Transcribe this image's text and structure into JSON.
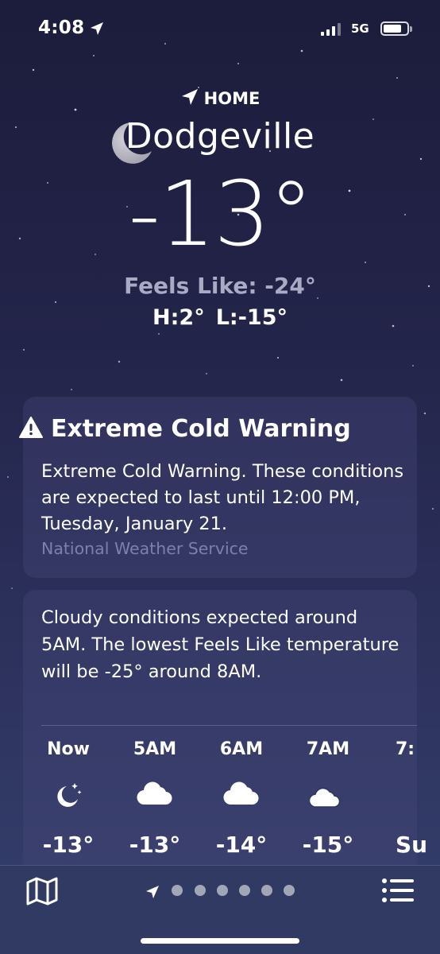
{
  "status_bar": {
    "time": "4:08",
    "network": "5G"
  },
  "header": {
    "home_label": "HOME",
    "city": "Dodgeville",
    "temperature": "-13°",
    "feels_like": "Feels Like: -24°",
    "high": "H:2°",
    "low": "L:-15°"
  },
  "warning": {
    "title": "Extreme Cold Warning",
    "body": "Extreme Cold Warning. These conditions are expected to last until 12:00 PM, Tuesday, January 21.",
    "source": "National Weather Service"
  },
  "hourly": {
    "summary": "Cloudy conditions expected around 5AM. The lowest Feels Like temperature will be -25° around 8AM.",
    "hours": [
      {
        "label": "Now",
        "icon": "moon-stars-icon",
        "temp": "-13°"
      },
      {
        "label": "5AM",
        "icon": "cloud-icon",
        "temp": "-13°"
      },
      {
        "label": "6AM",
        "icon": "cloud-icon",
        "temp": "-14°"
      },
      {
        "label": "7AM",
        "icon": "cloud-moon-icon",
        "temp": "-15°"
      },
      {
        "label": "7:",
        "icon": "",
        "temp": "Su"
      }
    ]
  },
  "colors": {
    "background_top": "#1c1c3c",
    "background_bottom": "#35406d",
    "secondary_text": "#a9aac4",
    "source_text": "#7d80a8"
  }
}
